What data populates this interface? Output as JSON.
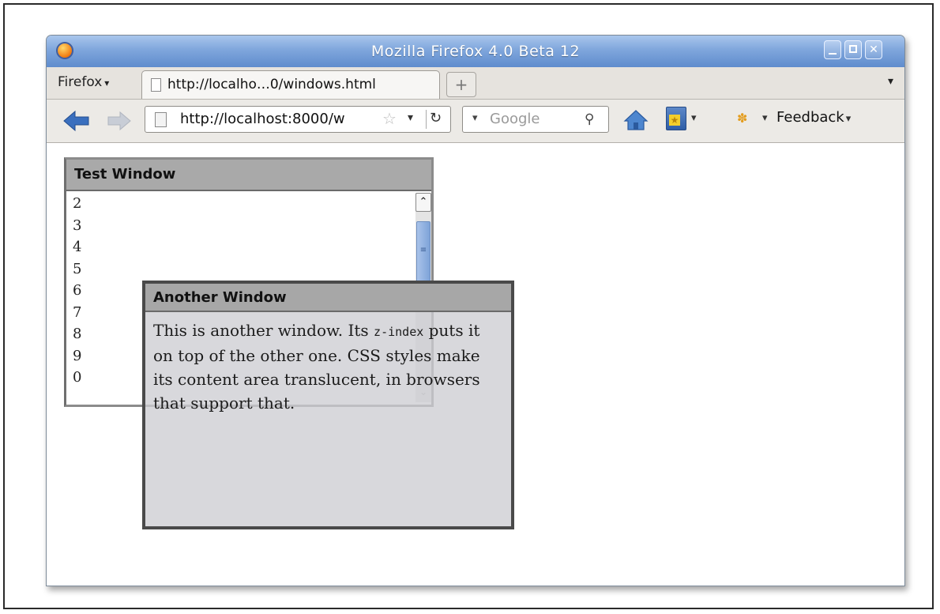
{
  "window": {
    "title": "Mozilla Firefox 4.0 Beta 12"
  },
  "menu": {
    "firefox_button": "Firefox"
  },
  "tabs": [
    {
      "label": "http://localho…0/windows.html"
    }
  ],
  "toolbar": {
    "url": "http://localhost:8000/w",
    "search_placeholder": "Google",
    "feedback_label": "Feedback"
  },
  "page": {
    "test_window": {
      "title": "Test Window",
      "lines": [
        "2",
        "3",
        "4",
        "5",
        "6",
        "7",
        "8",
        "9",
        "0"
      ]
    },
    "another_window": {
      "title": "Another Window",
      "text_1": "This is another window. Its",
      "code": "z-index",
      "text_2": " puts it on top of the other one. CSS styles make its content area translucent, in browsers that support that."
    }
  }
}
